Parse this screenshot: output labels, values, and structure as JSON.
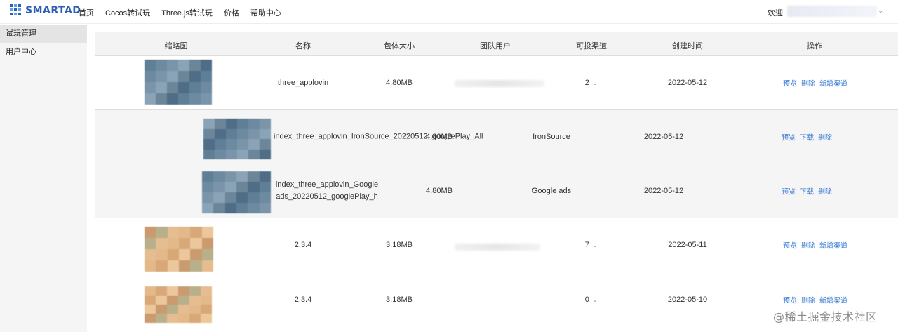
{
  "app": {
    "logo_text": "SMARTAD"
  },
  "nav": [
    "首页",
    "Cocos转试玩",
    "Three.js转试玩",
    "价格",
    "帮助中心"
  ],
  "user": {
    "welcome": "欢迎:"
  },
  "sidebar": {
    "items": [
      {
        "label": "试玩管理",
        "active": true
      },
      {
        "label": "用户中心",
        "active": false
      }
    ]
  },
  "table": {
    "headers": [
      "缩略图",
      "名称",
      "包体大小",
      "团队用户",
      "可投渠道",
      "创建时间",
      "操作"
    ],
    "rows": [
      {
        "name": "three_applovin",
        "size": "4.80MB",
        "channels": "2",
        "date": "2022-05-12",
        "ops": [
          "预览",
          "删除",
          "新增渠道"
        ],
        "thumb_palette": [
          "#5f7f97",
          "#6d8aa1",
          "#7a95aa",
          "#8aa3b7",
          "#6b8599",
          "#4f6d86"
        ]
      },
      {
        "name": "index_three_applovin_IronSource_20220512_googlePlay_All",
        "size": "4.80MB",
        "channel_name": "IronSource",
        "date": "2022-05-12",
        "ops": [
          "预览",
          "下载",
          "删除"
        ],
        "thumb_palette": [
          "#5f7f97",
          "#6d8aa1",
          "#7a95aa",
          "#8aa3b7",
          "#6b8599",
          "#4f6d86"
        ]
      },
      {
        "name": "index_three_applovin_Google ads_20220512_googlePlay_h",
        "size": "4.80MB",
        "channel_name": "Google ads",
        "date": "2022-05-12",
        "ops": [
          "预览",
          "下载",
          "删除"
        ],
        "thumb_palette": [
          "#5f7f97",
          "#6d8aa1",
          "#7a95aa",
          "#8aa3b7",
          "#6b8599",
          "#4f6d86"
        ]
      },
      {
        "name": "2.3.4",
        "size": "3.18MB",
        "channels": "7",
        "date": "2022-05-11",
        "ops": [
          "预览",
          "删除",
          "新增渠道"
        ],
        "thumb_palette": [
          "#e3b98a",
          "#d9a878",
          "#ecc79c",
          "#c99b6e",
          "#b8b08a",
          "#e6bd90"
        ]
      },
      {
        "name": "2.3.4",
        "size": "3.18MB",
        "channels": "0",
        "date": "2022-05-10",
        "ops": [
          "预览",
          "删除",
          "新增渠道"
        ],
        "thumb_palette": [
          "#e3b98a",
          "#d9a878",
          "#ecc79c",
          "#c99b6e",
          "#b8b08a",
          "#e6bd90"
        ]
      }
    ]
  },
  "watermark": "@稀土掘金技术社区",
  "colors": {
    "link": "#3a7bd5",
    "logo": "#2f5fb3"
  }
}
